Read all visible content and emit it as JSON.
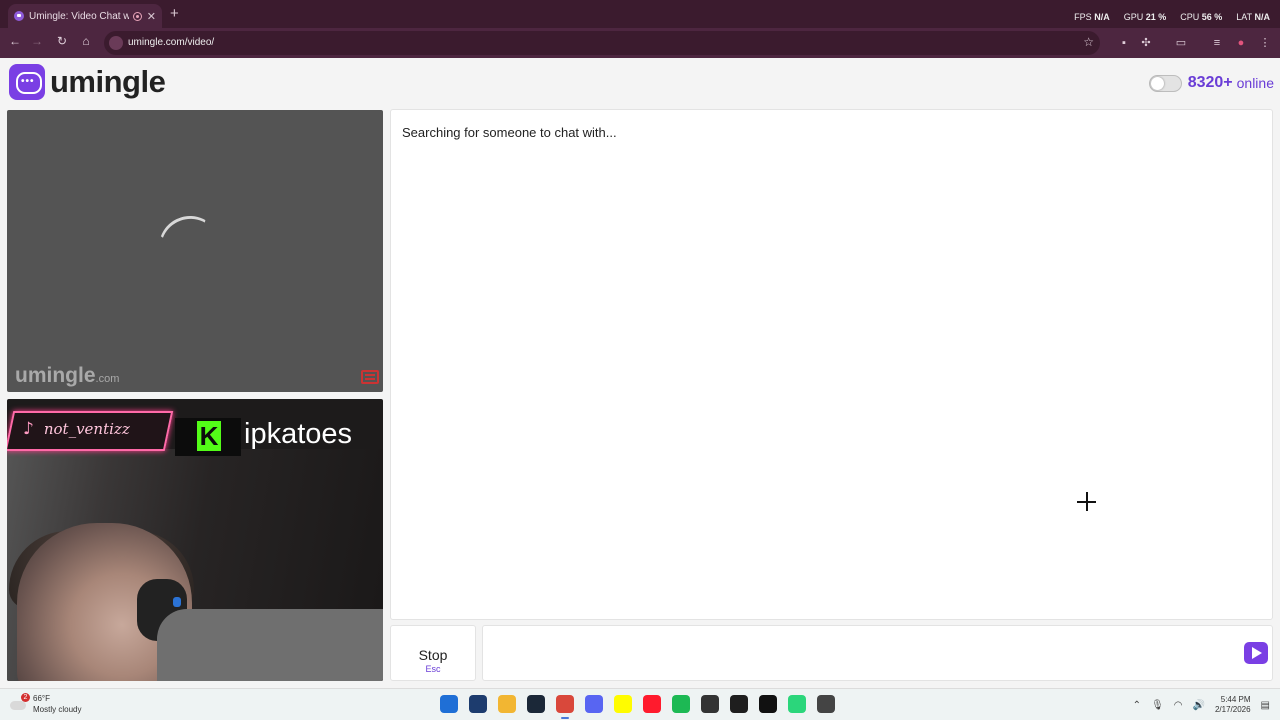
{
  "browser": {
    "tab_title": "Umingle: Video Chat with S",
    "tab_close": "✕",
    "new_tab": "+",
    "url": "umingle.com/video/",
    "perf": {
      "fps_label": "FPS",
      "fps_value": "N/A",
      "gpu_label": "GPU",
      "gpu_value": "21 %",
      "cpu_label": "CPU",
      "cpu_value": "56 %",
      "lat_label": "LAT",
      "lat_value": "N/A"
    }
  },
  "site": {
    "logo_text": "umingle",
    "online_count": "8320+",
    "online_label": "online"
  },
  "stranger_video": {
    "watermark": "umingle",
    "watermark_suffix": ".com"
  },
  "self_video": {
    "tiktok_handle": "not_ventizz",
    "kick_letter": "K",
    "kick_handle": "ipkatoes"
  },
  "chat": {
    "status_text": "Searching for someone to chat with...",
    "stop_label": "Stop",
    "stop_shortcut": "Esc",
    "message_placeholder": ""
  },
  "taskbar": {
    "weather_temp": "66°F",
    "weather_desc": "Mostly cloudy",
    "weather_badge": "2",
    "time": "5:44 PM",
    "date": "2/17/2026",
    "apps": [
      {
        "name": "start-icon",
        "color": "#1f6fd6"
      },
      {
        "name": "task-view-icon",
        "color": "#1d3c6e"
      },
      {
        "name": "file-explorer-icon",
        "color": "#f2b632"
      },
      {
        "name": "steam-icon",
        "color": "#1b2838"
      },
      {
        "name": "chrome-icon",
        "color": "#d9483b"
      },
      {
        "name": "discord-icon",
        "color": "#5865f2"
      },
      {
        "name": "snapchat-icon",
        "color": "#fffc00"
      },
      {
        "name": "opera-icon",
        "color": "#ff1b2d"
      },
      {
        "name": "spotify-icon",
        "color": "#1db954"
      },
      {
        "name": "davinci-icon",
        "color": "#333333"
      },
      {
        "name": "terminal-icon",
        "color": "#1e1e1e"
      },
      {
        "name": "rockstar-icon",
        "color": "#111111"
      },
      {
        "name": "app-green-icon",
        "color": "#2bd67b"
      },
      {
        "name": "app-red-icon",
        "color": "#444444"
      }
    ]
  },
  "colors": {
    "brand": "#7a3fe4",
    "online": "#6a3dd6",
    "chrome": "#4d2640",
    "titlebar": "#3b1b2e"
  }
}
